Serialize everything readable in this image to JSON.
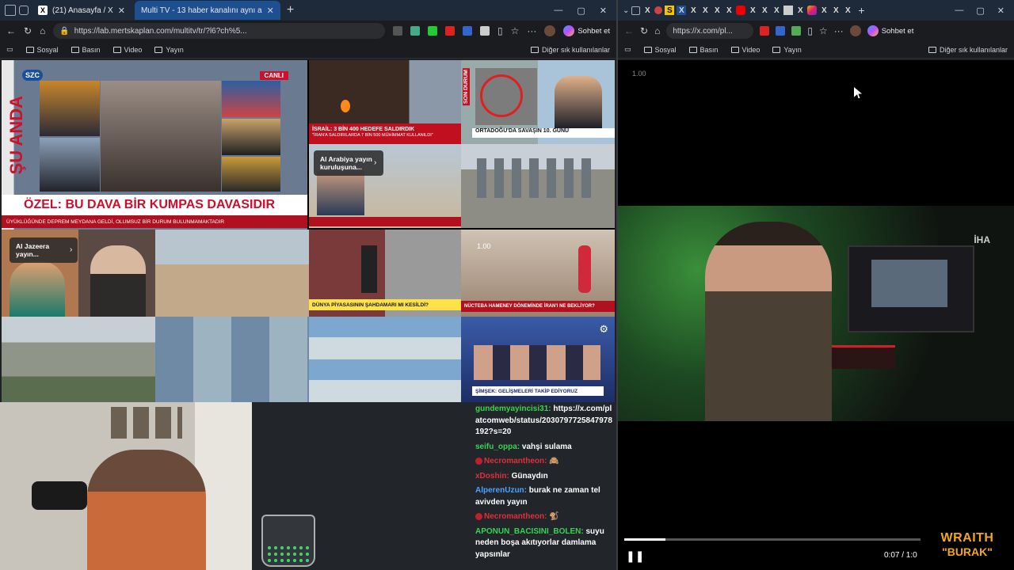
{
  "left": {
    "tabs": [
      {
        "label": "(21) Anasayfa / X"
      },
      {
        "label": "Multi TV - 13 haber kanalını aynı a"
      }
    ],
    "url": "https://lab.mertskaplan.com/multitv/tr/?l6?ch%5...",
    "copilot_label": "Sohbet et",
    "bookmarks": [
      "Sosyal",
      "Basın",
      "Video",
      "Yayın"
    ],
    "other_bookmarks": "Diğer sık kullanılanlar",
    "tiles": {
      "szc_logo": "SZC",
      "su_anda": "ŞU ANDA",
      "canli": "CANLI",
      "szc_headline": "ÖZEL: BU DAVA BİR KUMPAS DAVASIDIR",
      "szc_ticker": "ÜYÜKLÜĞÜNDE DEPREM MEYDANA GELDİ, OLUMSUZ BİR DURUM BULUNMAMAKTADIR",
      "israil": "İSRAİL: 3 BİN 400 HEDEFE SALDIRDIK",
      "israil_sub": "\"İRAN'A SALDIRILARDA 7 BİN 500 MÜHİMMAT KULLANILDI\"",
      "son_durum": "SON DURUM",
      "ortadogu": "ORTADOĞU'DA SAVAŞIN 10. GÜNÜ",
      "al_arabiya": "Al Arabiya yayın kuruluşuna...",
      "al_jazeera": "Al Jazeera yayın...",
      "dunya": "DÜNYA PİYASASININ ŞAHDAMARI MI KESİLDİ?",
      "nuctebaa": "NÜCTEBA HAMENEY DÖNEMİNDE İRAN'I NE BEKLİYOR?",
      "simsek": "ŞİMŞEK: GELİŞMELERİ TAKİP EDİYORUZ",
      "speed": "1.00"
    },
    "chat": [
      {
        "user": "gundemyayincisi31:",
        "color": "#39d353",
        "text": "https://x.com/platcomweb/status/2030797725847978192?s=20"
      },
      {
        "user": "seifu_oppa:",
        "color": "#39d353",
        "text": "vahşi sulama"
      },
      {
        "user": "Necromantheon:",
        "color": "#e0303a",
        "text": "🙈",
        "badge": true
      },
      {
        "user": "xDoshin:",
        "color": "#e0303a",
        "text": "Günaydın"
      },
      {
        "user": "AlperenUzun:",
        "color": "#4aa3ff",
        "text": "burak ne zaman tel avivden yayın"
      },
      {
        "user": "Necromantheon:",
        "color": "#e0303a",
        "text": "🐒",
        "badge": true
      },
      {
        "user": "APONUN_BACISINI_BOLEN:",
        "color": "#39d353",
        "text": "suyu neden boşa akıtıyorlar damlama yapsınlar"
      }
    ]
  },
  "right": {
    "url": "https://x.com/pl...",
    "copilot_label": "Sohbet et",
    "bookmarks": [
      "Sosyal",
      "Basın",
      "Video",
      "Yayın"
    ],
    "other_bookmarks": "Diğer sık kullanılanlar",
    "speed": "1.00",
    "watermark": "İHA",
    "time": "0:07 / 1:0",
    "progress": 0.108,
    "brand_line1": "WRAITH",
    "brand_line2": "\"BURAK\""
  }
}
